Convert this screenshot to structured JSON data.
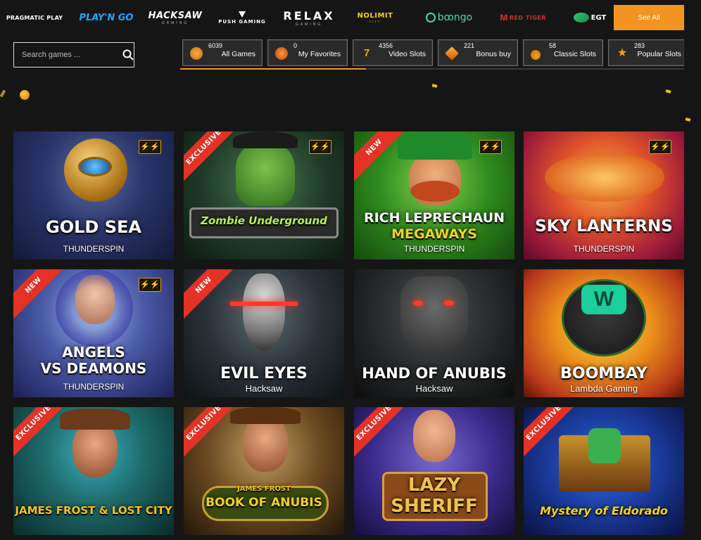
{
  "providers": [
    {
      "label": "PRAGMATIC PLAY"
    },
    {
      "label": "PLAY'N GO"
    },
    {
      "label": "HACKSAW",
      "sub": "GAMING"
    },
    {
      "label": "PUSH GAMING"
    },
    {
      "label": "RELAX",
      "sub": "GAMING"
    },
    {
      "label": "NOLIMIT",
      "sub": "CITY"
    },
    {
      "label": "bꝏngo"
    },
    {
      "label": "RED TIGER"
    },
    {
      "label": "EGT"
    }
  ],
  "see_all_label": "See All",
  "search": {
    "placeholder": "Search games ..."
  },
  "categories": [
    {
      "count": "6039",
      "label": "All Games",
      "icon": "sun-icon"
    },
    {
      "count": "0",
      "label": "My Favorites",
      "icon": "heart-icon"
    },
    {
      "count": "4356",
      "label": "Video Slots",
      "icon": "seven-icon"
    },
    {
      "count": "221",
      "label": "Bonus buy",
      "icon": "diamond-icon"
    },
    {
      "count": "58",
      "label": "Classic Slots",
      "icon": "cherry-icon"
    },
    {
      "count": "283",
      "label": "Popular Slots",
      "icon": "star-icon"
    }
  ],
  "games": [
    {
      "title": "GOLD SEA",
      "provider": "THUNDERSPIN",
      "badge": "",
      "bolt": true
    },
    {
      "title": "Zombie Underground",
      "provider": "",
      "badge": "EXCLUSIVE",
      "bolt": true
    },
    {
      "title": "RICH LEPRECHAUN",
      "title2": "MEGAWAYS",
      "provider": "THUNDERSPIN",
      "badge": "NEW",
      "bolt": true
    },
    {
      "title": "SKY LANTERNS",
      "provider": "THUNDERSPIN",
      "badge": "",
      "bolt": true
    },
    {
      "title": "ANGELS",
      "title2": "VS DEAMONS",
      "provider": "THUNDERSPIN",
      "badge": "NEW",
      "bolt": true
    },
    {
      "title": "EVIL EYES",
      "provider": "Hacksaw",
      "badge": "NEW",
      "bolt": false
    },
    {
      "title": "HAND OF ANUBIS",
      "provider": "Hacksaw",
      "badge": "",
      "bolt": false
    },
    {
      "title": "BOOMBAY",
      "provider": "Lambda Gaming",
      "badge": "",
      "bolt": false
    },
    {
      "title": "JAMES FROST & LOST CITY",
      "provider": "",
      "badge": "EXCLUSIVE",
      "bolt": false
    },
    {
      "title": "BOOK OF ANUBIS",
      "title_top": "JAMES FROST",
      "provider": "",
      "badge": "EXCLUSIVE",
      "bolt": false
    },
    {
      "title": "LAZY",
      "title2": "SHERIFF",
      "provider": "",
      "badge": "EXCLUSIVE",
      "bolt": false
    },
    {
      "title": "Mystery of Eldorado",
      "provider": "",
      "badge": "EXCLUSIVE",
      "bolt": false
    }
  ]
}
